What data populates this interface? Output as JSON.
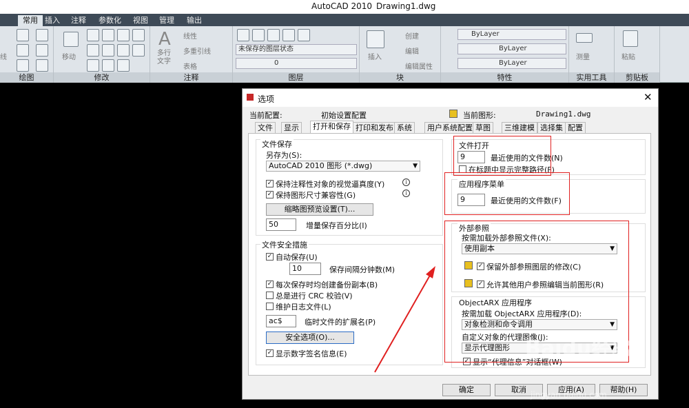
{
  "app": {
    "title": "AutoCAD 2010",
    "file": "Drawing1.dwg"
  },
  "tabs": [
    "常用",
    "插入",
    "注释",
    "参数化",
    "视图",
    "管理",
    "输出"
  ],
  "ribbon": {
    "panels": [
      "绘图",
      "修改",
      "注释",
      "图层",
      "块",
      "特性",
      "实用工具",
      "剪贴板"
    ],
    "draw_label": "线",
    "modify_move": "移动",
    "annot_text": "多行文字",
    "annot_linear": "线性",
    "annot_mleader": "多重引线",
    "annot_table": "表格",
    "layer_state": "未保存的图层状态",
    "layer_zero": "0",
    "block_insert": "插入",
    "block_create": "创建",
    "block_edit": "编辑",
    "block_editattr": "编辑属性",
    "bylayer_color": "ByLayer",
    "bylayer_line": "ByLayer",
    "bylayer_weight": "ByLayer",
    "measure": "测量",
    "paste": "粘贴"
  },
  "dialog": {
    "title": "选项",
    "current_profile_label": "当前配置:",
    "current_profile": "初始设置配置",
    "current_drawing_label": "当前图形:",
    "current_drawing": "Drawing1.dwg",
    "tabs": [
      "文件",
      "显示",
      "打开和保存",
      "打印和发布",
      "系统",
      "用户系统配置",
      "草图",
      "三维建模",
      "选择集",
      "配置"
    ],
    "file_save": {
      "title": "文件保存",
      "save_as_label": "另存为(S):",
      "save_as_value": "AutoCAD 2010 图形 (*.dwg)",
      "keep_annot": "保持注释性对象的视觉逼真度(Y)",
      "keep_size": "保持图形尺寸兼容性(G)",
      "thumb_btn": "缩略图预览设置(T)...",
      "incr_value": "50",
      "incr_label": "增量保存百分比(I)"
    },
    "safety": {
      "title": "文件安全措施",
      "autosave": "自动保存(U)",
      "interval_value": "10",
      "interval_label": "保存间隔分钟数(M)",
      "backup": "每次保存时均创建备份副本(B)",
      "crc": "总是进行 CRC 校验(V)",
      "log": "维护日志文件(L)",
      "ext_value": "ac$",
      "ext_label": "临时文件的扩展名(P)",
      "sec_btn": "安全选项(O)...",
      "digsig": "显示数字签名信息(E)"
    },
    "file_open": {
      "title": "文件打开",
      "recent_value": "9",
      "recent_label": "最近使用的文件数(N)",
      "fullpath": "在标题中显示完整路径(F)"
    },
    "app_menu": {
      "title": "应用程序菜单",
      "recent_value": "9",
      "recent_label": "最近使用的文件数(F)"
    },
    "xref": {
      "title": "外部参照",
      "demand_label": "按需加载外部参照文件(X):",
      "demand_value": "使用副本",
      "keep_layer": "保留外部参照图层的修改(C)",
      "allow_edit": "允许其他用户参照编辑当前图形(R)"
    },
    "arx": {
      "title": "ObjectARX 应用程序",
      "load_label": "按需加载 ObjectARX 应用程序(D):",
      "load_value": "对象检测和命令调用",
      "proxy_label": "自定义对象的代理图像(J):",
      "proxy_value": "显示代理图形",
      "proxy_info": "显示“代理信息”对话框(W)"
    },
    "buttons": {
      "ok": "确定",
      "cancel": "取消",
      "apply": "应用(A)",
      "help": "帮助(H)"
    }
  },
  "watermark": {
    "logo": "Baidu经验",
    "url": "jingyan.baidu.com"
  }
}
